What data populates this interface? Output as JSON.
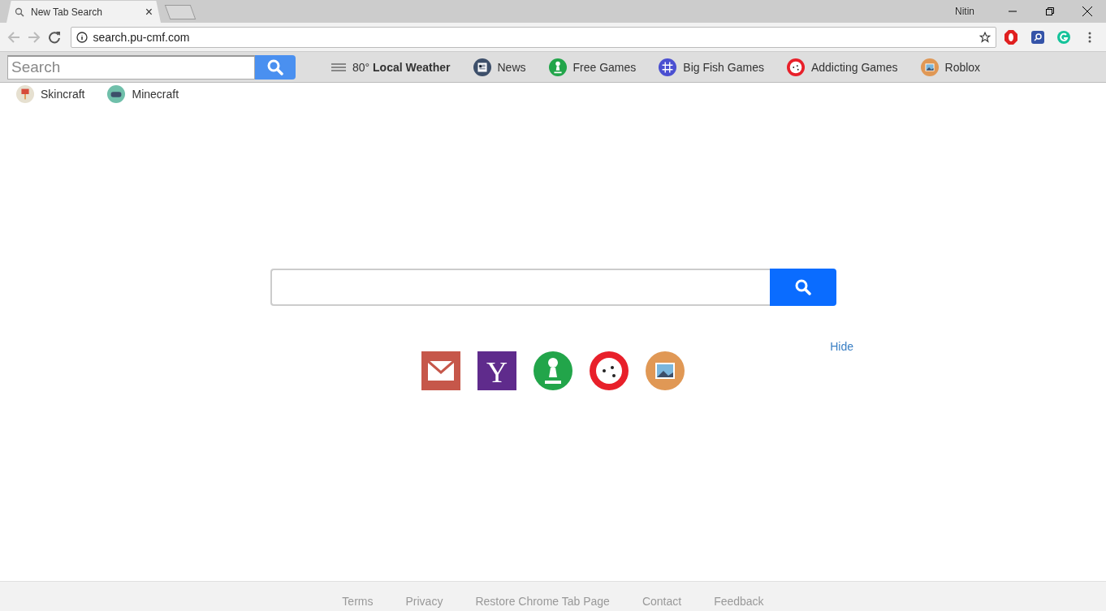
{
  "browser": {
    "tab": {
      "title": "New Tab Search",
      "close": "×"
    },
    "user": "Nitin",
    "url": "search.pu-cmf.com"
  },
  "toolbar": {
    "search": {
      "placeholder": "Search"
    },
    "links": [
      {
        "kind": "weather",
        "label": "80° **Local Weather**"
      },
      {
        "kind": "news",
        "label": "News"
      },
      {
        "kind": "pawn",
        "label": "Free Games"
      },
      {
        "kind": "tictactoe",
        "label": "Big Fish Games"
      },
      {
        "kind": "dice",
        "label": "Addicting Games"
      },
      {
        "kind": "photo",
        "label": "Roblox"
      },
      {
        "kind": "brush",
        "label": "Skincraft"
      },
      {
        "kind": "gamepad",
        "label": "Minecraft"
      }
    ]
  },
  "main": {
    "hide": "Hide",
    "tiles": [
      {
        "kind": "mail"
      },
      {
        "kind": "yahoo",
        "letter": "Y"
      },
      {
        "kind": "pawn"
      },
      {
        "kind": "dice"
      },
      {
        "kind": "photo"
      }
    ]
  },
  "footer": [
    "Terms",
    "Privacy",
    "Restore Chrome Tab Page",
    "Contact",
    "Feedback"
  ]
}
